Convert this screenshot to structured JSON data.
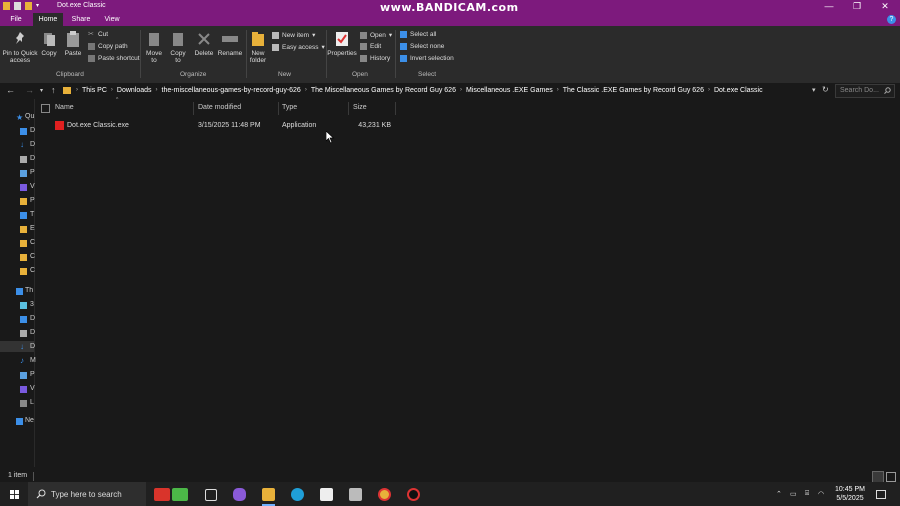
{
  "window": {
    "title": "Dot.exe Classic",
    "watermark": "www.BANDICAM.com",
    "minimize": "—",
    "maximize": "❐",
    "close": "✕"
  },
  "tabs": [
    {
      "label": "File"
    },
    {
      "label": "Home"
    },
    {
      "label": "Share"
    },
    {
      "label": "View"
    }
  ],
  "ribbon": {
    "clipboard": {
      "pin_label": "Pin to Quick access",
      "copy_label": "Copy",
      "paste_label": "Paste",
      "cut_label": "Cut",
      "copy_path_label": "Copy path",
      "paste_shortcut_label": "Paste shortcut",
      "group_label": "Clipboard"
    },
    "organize": {
      "move_to_label": "Move to",
      "copy_to_label": "Copy to",
      "delete_label": "Delete",
      "rename_label": "Rename",
      "group_label": "Organize"
    },
    "new": {
      "new_folder_label": "New folder",
      "new_item_label": "New item",
      "easy_access_label": "Easy access",
      "group_label": "New"
    },
    "open": {
      "properties_label": "Properties",
      "open_label": "Open",
      "edit_label": "Edit",
      "history_label": "History",
      "group_label": "Open"
    },
    "select": {
      "select_all_label": "Select all",
      "select_none_label": "Select none",
      "invert_label": "Invert selection",
      "group_label": "Select"
    }
  },
  "address": {
    "crumbs": [
      "This PC",
      "Downloads",
      "the-miscellaneous-games-by-record-guy-626",
      "The Miscellaneous Games by Record Guy 626",
      "Miscellaneous .EXE Games",
      "The Classic .EXE Games by Record Guy 626",
      "Dot.exe Classic"
    ],
    "search_placeholder": "Search Do..."
  },
  "columns": {
    "name": "Name",
    "date": "Date modified",
    "type": "Type",
    "size": "Size"
  },
  "files": [
    {
      "name": "Dot.exe Classic.exe",
      "date": "3/15/2025 11:48 PM",
      "type": "Application",
      "size": "43,231 KB"
    }
  ],
  "nav_pane": {
    "items": [
      "Qu",
      "D",
      "D",
      "D",
      "P",
      "V",
      "P",
      "T",
      "E",
      "C",
      "C",
      "C",
      "Th",
      "3",
      "D",
      "D",
      "D",
      "M",
      "P",
      "V",
      "L",
      "Ne"
    ]
  },
  "status": {
    "item_count": "1 item"
  },
  "taskbar": {
    "search_placeholder": "Type here to search",
    "time": "10:45 PM",
    "date": "5/5/2025"
  },
  "colors": {
    "title_bar": "#7d1a7d",
    "background": "#191919",
    "ribbon": "#2b2b2b",
    "accent": "#3c8fe8"
  }
}
